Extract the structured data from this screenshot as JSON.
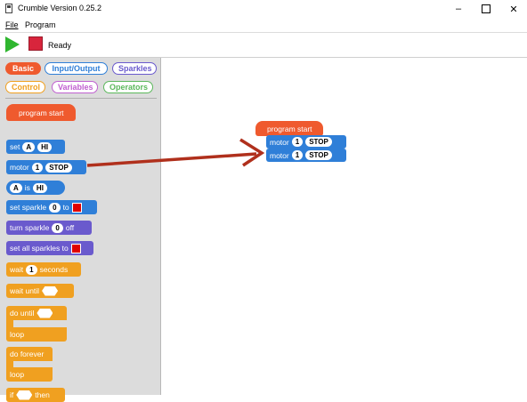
{
  "window": {
    "title": "Crumble Version 0.25.2"
  },
  "menu": {
    "file": "File",
    "program": "Program"
  },
  "toolbar": {
    "status": "Ready"
  },
  "tabs": {
    "basic": "Basic",
    "input_output": "Input/Output",
    "sparkles": "Sparkles",
    "control": "Control",
    "variables": "Variables",
    "operators": "Operators"
  },
  "palette": {
    "program_start": "program start",
    "set": {
      "label": "set",
      "var": "A",
      "value": "HI"
    },
    "motor": {
      "label": "motor",
      "num": "1",
      "state": "STOP"
    },
    "compare": {
      "var": "A",
      "op": "is",
      "value": "HI"
    },
    "set_sparkle": {
      "label": "set sparkle",
      "num": "0",
      "to": "to"
    },
    "turn_sparkle": {
      "label": "turn sparkle",
      "num": "0",
      "off": "off"
    },
    "set_all": {
      "label": "set all sparkles to"
    },
    "wait": {
      "label": "wait",
      "num": "1",
      "unit": "seconds"
    },
    "wait_until": "wait until",
    "do_until": "do until",
    "loop": "loop",
    "do_forever": "do forever",
    "loop2": "loop",
    "if_then": {
      "if": "if",
      "then": "then"
    }
  },
  "canvas": {
    "program_start": "program start",
    "motor1": {
      "label": "motor",
      "num": "1",
      "state": "STOP"
    },
    "motor2": {
      "label": "motor",
      "num": "1",
      "state": "STOP"
    }
  },
  "colors": {
    "basic": "#ef5a2e",
    "io": "#2f7fd8",
    "sparkles": "#6a5acd",
    "control": "#f0a020",
    "variables": "#c060d0",
    "operators": "#5cb85c",
    "arrow": "#b0301c",
    "sparkle_swatch": "#e00000"
  },
  "icons": {
    "play": "play-icon",
    "stop": "stop-icon",
    "app": "app-icon"
  }
}
